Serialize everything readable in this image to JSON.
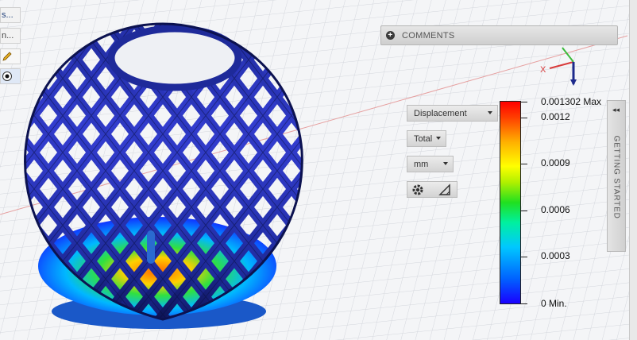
{
  "toolbar": {
    "item1_label": "s...",
    "item2_label": "n...",
    "pencil_icon": "pencil-icon",
    "radio_icon": "radio-icon"
  },
  "comments": {
    "label": "COMMENTS",
    "icon": "plus-circle-icon"
  },
  "axes": {
    "x_label": "X"
  },
  "result_controls": {
    "result_type": "Displacement",
    "component": "Total",
    "unit": "mm",
    "settings_icon": "gear-icon",
    "probe_icon": "triangle-ruler-icon"
  },
  "legend": {
    "max_label": "0.001302 Max",
    "min_label": "0 Min.",
    "ticks": [
      "0.0012",
      "0.0009",
      "0.0006",
      "0.0003"
    ],
    "max_value": 0.001302,
    "min_value": 0,
    "tick_values": [
      0.0012,
      0.0009,
      0.0006,
      0.0003
    ]
  },
  "getting_started": {
    "label": "GETTING STARTED",
    "collapse_icon": "double-chevron-left-icon"
  },
  "colors": {
    "model_blue": "#1e2a9a",
    "grid": "#d6d9de",
    "x_axis": "#e25050"
  }
}
